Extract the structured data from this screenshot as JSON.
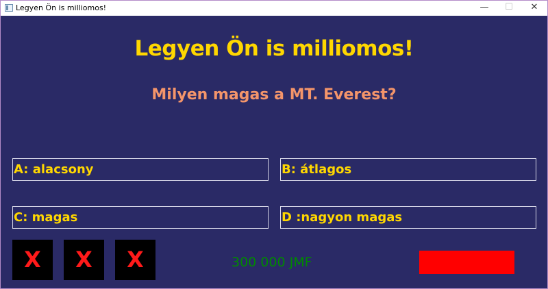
{
  "window": {
    "title": "Legyen Ön is milliomos!",
    "controls": {
      "minimize": "—",
      "maximize": "☐",
      "close": "✕"
    }
  },
  "game": {
    "heading": "Legyen Ön is milliomos!",
    "question": "Milyen magas a MT. Everest?",
    "answers": [
      {
        "label": "A: alacsony"
      },
      {
        "label": "B: átlagos"
      },
      {
        "label": "C: magas"
      },
      {
        "label": "D :nagyon magas"
      }
    ],
    "lifelines": [
      {
        "label": "X"
      },
      {
        "label": "X"
      },
      {
        "label": "X"
      }
    ],
    "prize": "300 000 JMF"
  },
  "colors": {
    "background": "#2a2a66",
    "heading": "#ffd700",
    "question": "#f4956a",
    "answer_text": "#ffd700",
    "lifeline_bg": "#000000",
    "lifeline_x": "#ff1a1a",
    "prize": "#008a00",
    "action_button": "#ff0000"
  },
  "icons": {
    "app": "app-window-icon",
    "minimize": "minimize-icon",
    "maximize": "maximize-icon",
    "close": "close-icon"
  }
}
